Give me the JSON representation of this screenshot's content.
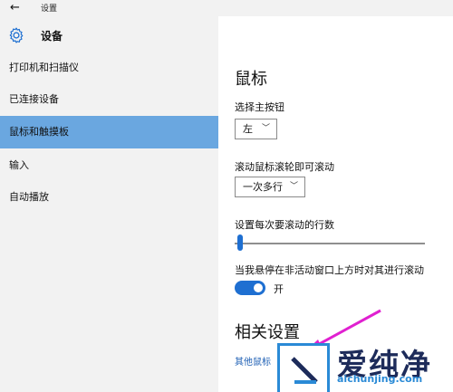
{
  "window": {
    "title": "设置",
    "back_icon": "back-arrow-icon"
  },
  "header": {
    "title": "设备",
    "icon": "gear-icon"
  },
  "sidebar": {
    "items": [
      {
        "label": "打印机和扫描仪",
        "active": false
      },
      {
        "label": "已连接设备",
        "active": false
      },
      {
        "label": "鼠标和触摸板",
        "active": true
      },
      {
        "label": "输入",
        "active": false
      },
      {
        "label": "自动播放",
        "active": false
      }
    ]
  },
  "main": {
    "title": "鼠标",
    "primary_button": {
      "label": "选择主按钮",
      "value": "左"
    },
    "scroll_mode": {
      "label": "滚动鼠标滚轮即可滚动",
      "value": "一次多行"
    },
    "lines_per_scroll": {
      "label": "设置每次要滚动的行数",
      "value_fraction": 0.02
    },
    "inactive_scroll": {
      "label": "当我悬停在非活动窗口上方时对其进行滚动",
      "state": "开",
      "on": true
    },
    "related": {
      "title": "相关设置",
      "link": "其他鼠标"
    }
  },
  "watermark": {
    "text": "爱纯净",
    "url": "aichunjing.com"
  },
  "colors": {
    "accent": "#1e6fd1",
    "active_item": "#6aa7e0",
    "sidebar_bg": "#f2f2f2",
    "arrow": "#e020d0"
  }
}
